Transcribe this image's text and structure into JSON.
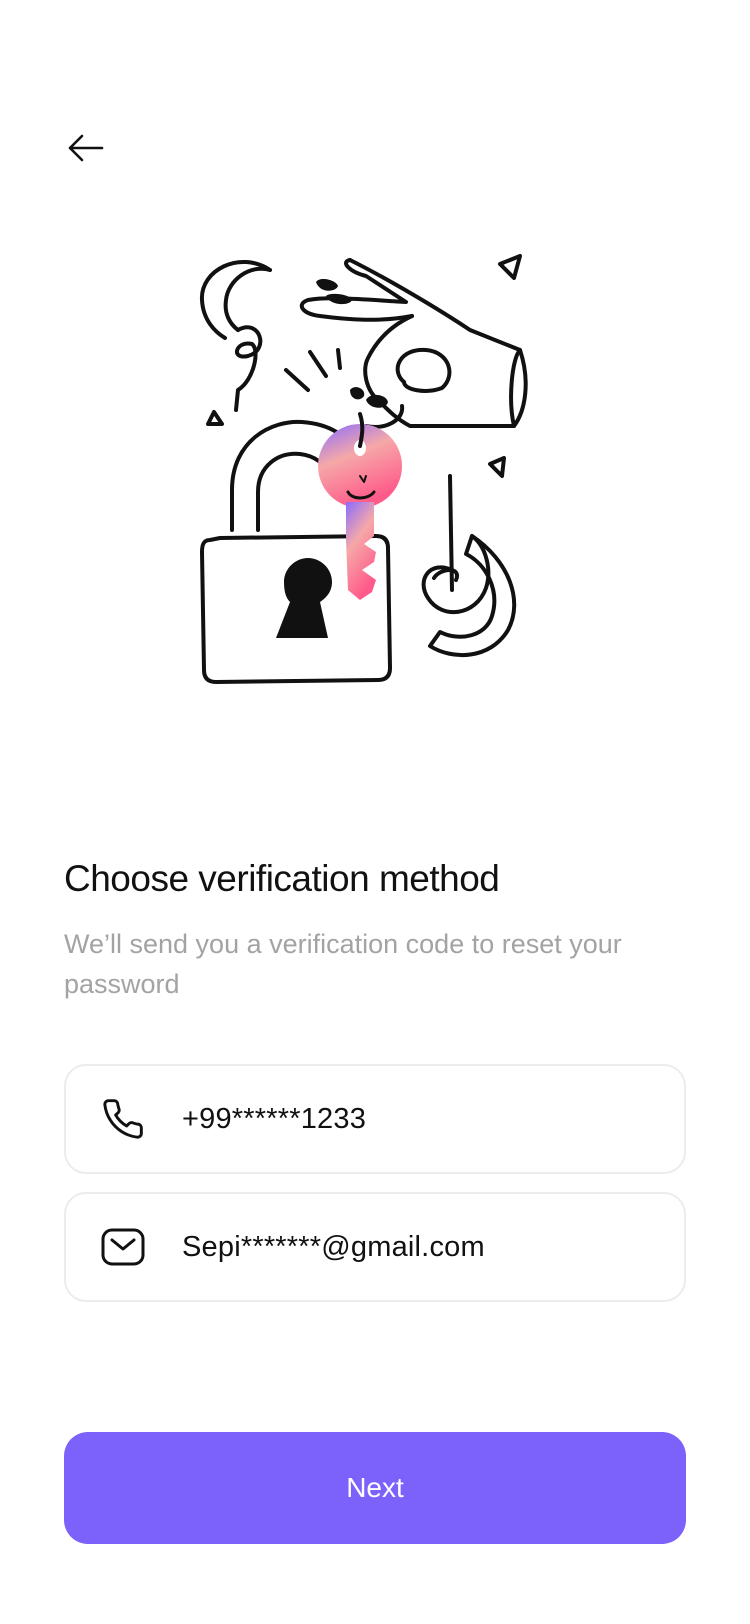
{
  "header": {
    "back_icon": "arrow-left-icon"
  },
  "content": {
    "title": "Choose verification method",
    "subtitle": "We’ll send you a verification code to reset your password"
  },
  "options": [
    {
      "icon": "phone-icon",
      "label": "+99******1233"
    },
    {
      "icon": "mail-icon",
      "label": "Sepi*******@gmail.com"
    }
  ],
  "actions": {
    "next_label": "Next"
  },
  "colors": {
    "accent": "#7c61fb",
    "option_border": "#ececec",
    "subtitle": "#a3a3a3"
  }
}
